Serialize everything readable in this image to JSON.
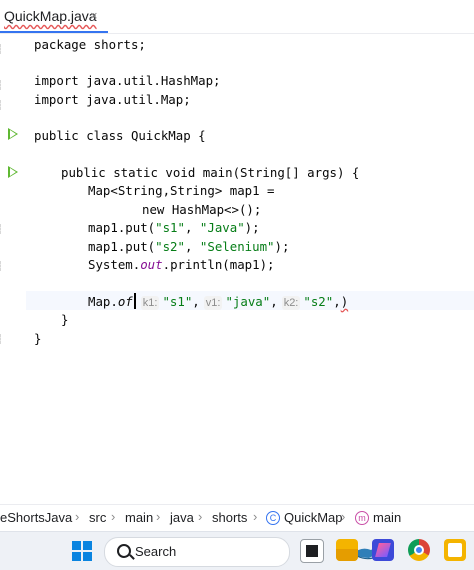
{
  "tab": {
    "label": "QuickMap.java",
    "close": "×"
  },
  "code": {
    "l1": "package shorts;",
    "l2": "import java.util.HashMap;",
    "l3": "import java.util.Map;",
    "l4": "public class QuickMap {",
    "l5": "public static void main(String[] args) {",
    "l6": "Map<String,String> map1 =",
    "l7": "new HashMap<>();",
    "l8_pre": "map1.put(",
    "l8_k": "\"s1\"",
    "l8_mid": ", ",
    "l8_v": "\"Java\"",
    "l8_post": ");",
    "l9_pre": "map1.put(",
    "l9_k": "\"s2\"",
    "l9_mid": ", ",
    "l9_v": "\"Selenium\"",
    "l9_post": ");",
    "l10_pre": "System.",
    "l10_out": "out",
    "l10_post": ".println(map1);",
    "l11_pre": "Map.",
    "l11_of": "of",
    "hint_k1": "k1:",
    "v_s1": "\"s1\"",
    "comma1": ",",
    "hint_v1": "v1:",
    "v_java": "\"java\"",
    "comma2": ",",
    "hint_k2": "k2:",
    "v_s2": "\"s2\"",
    "comma3": ",",
    "paren": ")",
    "l12": "}",
    "l13": "}"
  },
  "breadcrumb": {
    "project": "eShortsJava",
    "src": "src",
    "main": "main",
    "java": "java",
    "shorts": "shorts",
    "class": "QuickMap",
    "method": "main",
    "sep": "›"
  },
  "taskbar": {
    "search_label": "Search"
  },
  "colors": {
    "accent": "#3574f0",
    "string": "#067d17",
    "run": "#5fb832"
  }
}
